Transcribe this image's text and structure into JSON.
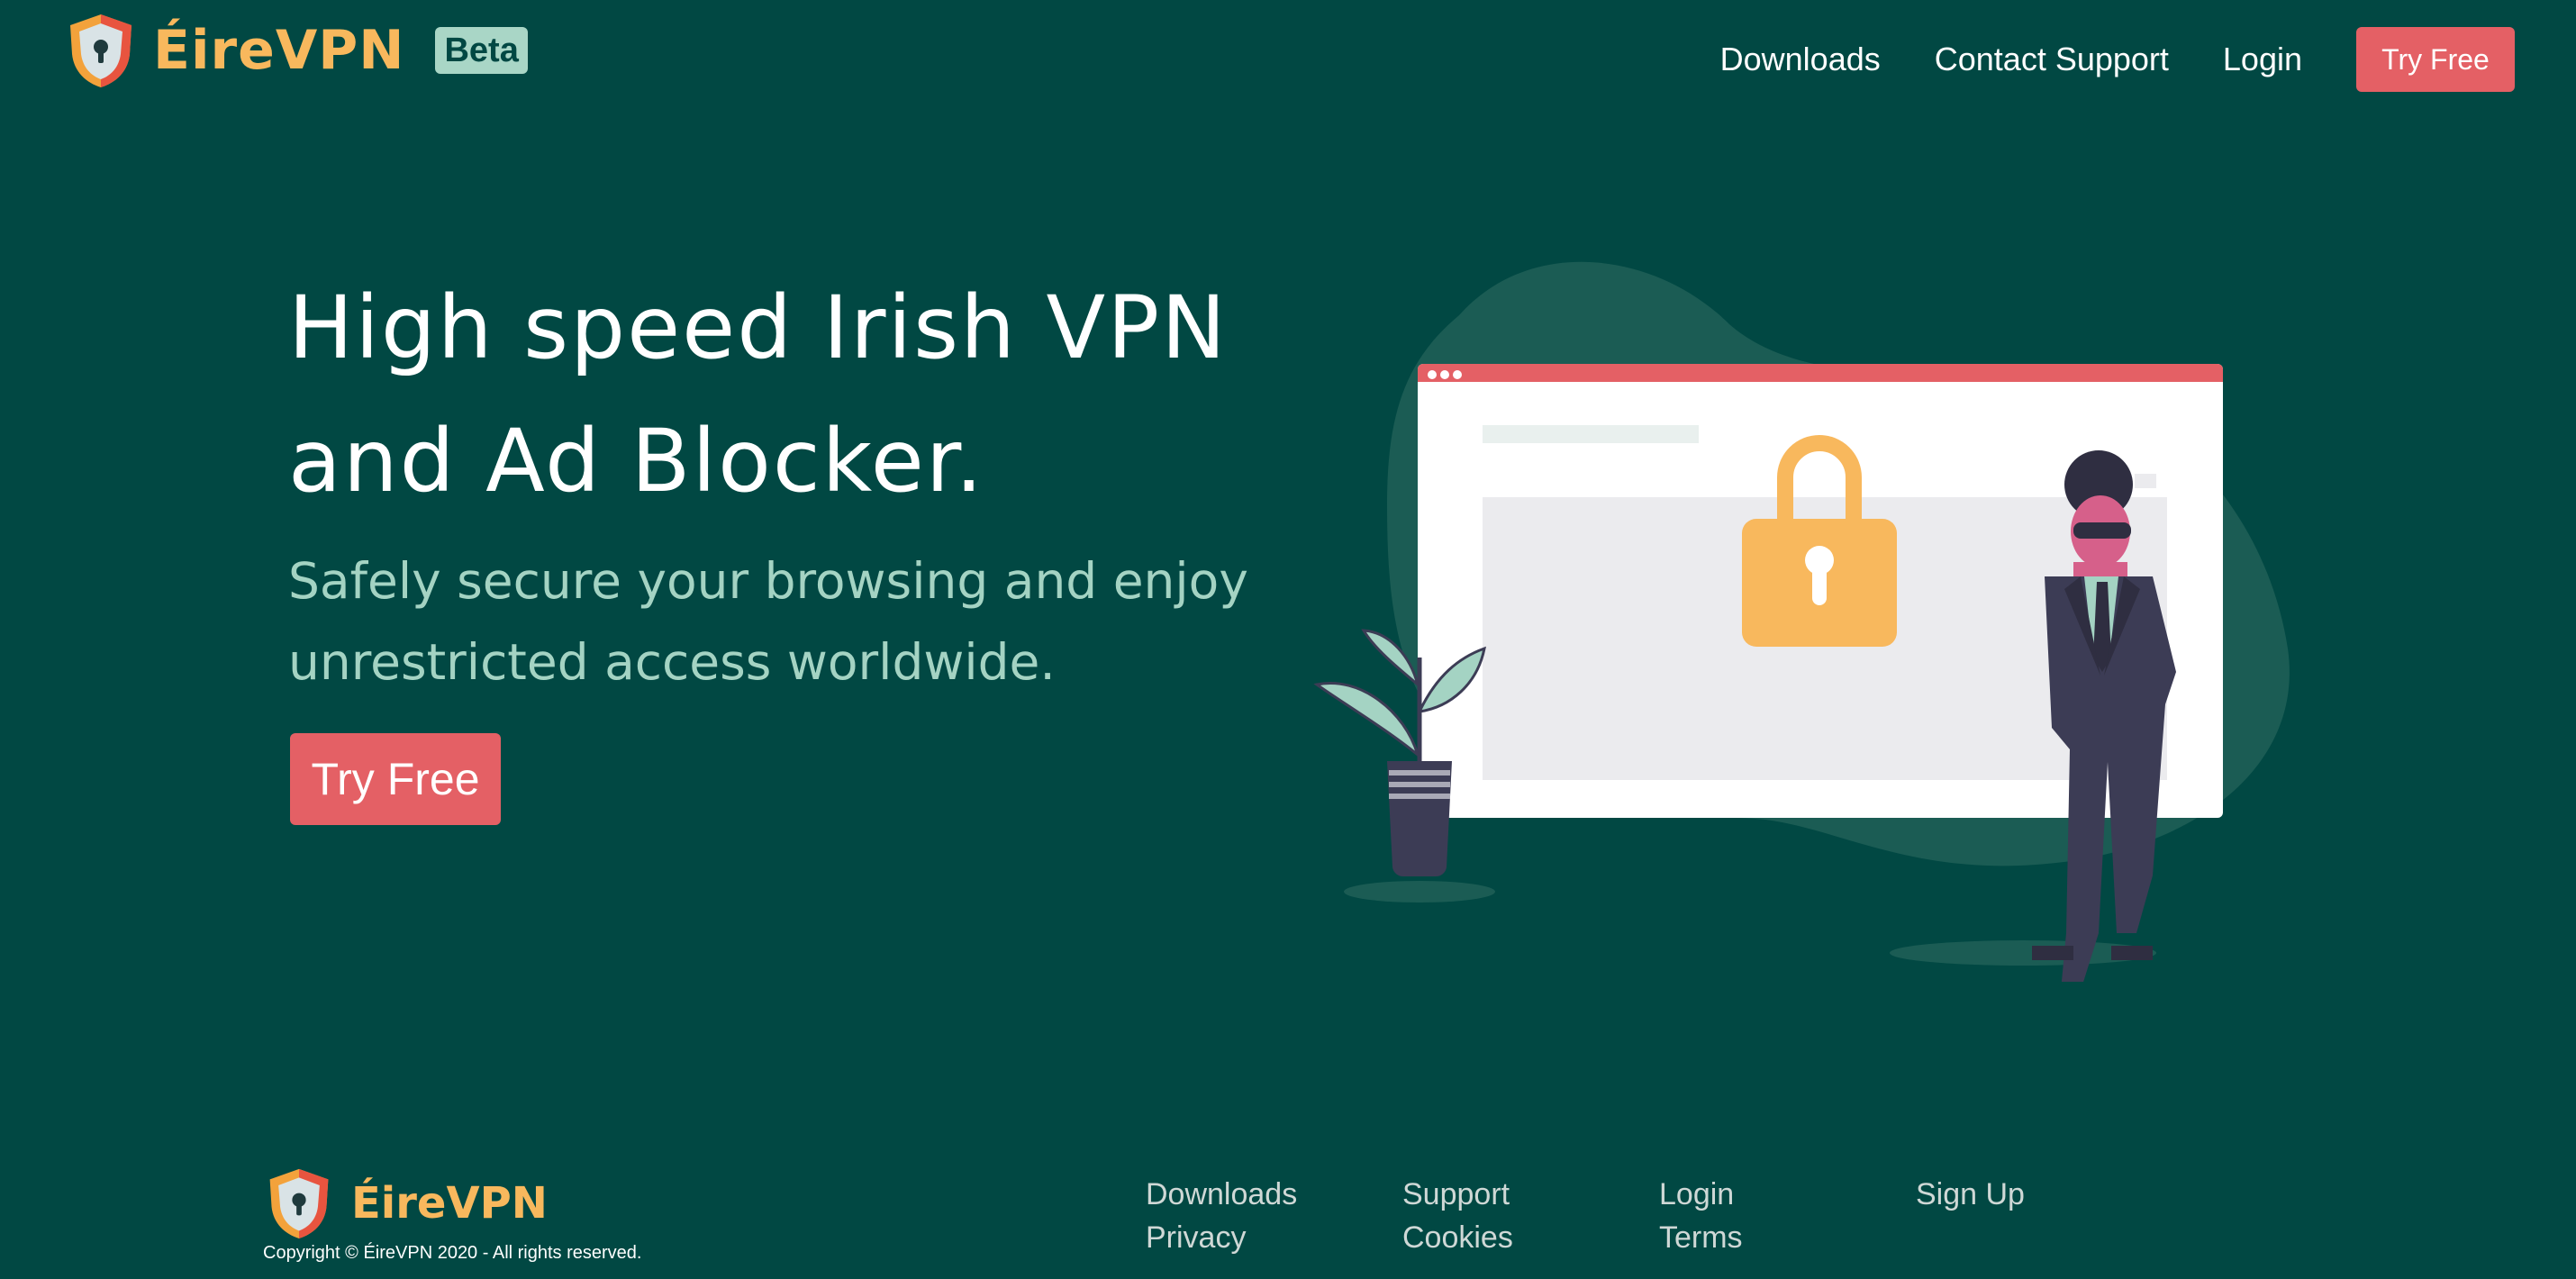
{
  "header": {
    "brand_name": "ÉireVPN",
    "beta_label": "Beta",
    "nav": {
      "downloads": "Downloads",
      "contact_support": "Contact Support",
      "login": "Login",
      "try_free": "Try Free"
    }
  },
  "hero": {
    "title_line1": "High speed Irish VPN",
    "title_line2": "and Ad Blocker.",
    "subtitle_line1": "Safely secure your browsing and enjoy",
    "subtitle_line2": "unrestricted access worldwide.",
    "cta_label": "Try Free",
    "illustration_icons": [
      "browser-window-icon",
      "padlock-icon",
      "plant-icon",
      "person-in-suit-icon"
    ]
  },
  "footer": {
    "brand_name": "ÉireVPN",
    "copyright": "Copyright © ÉireVPN 2020 - All rights reserved.",
    "columns": [
      [
        "Downloads",
        "Privacy"
      ],
      [
        "Support",
        "Cookies"
      ],
      [
        "Login",
        "Terms"
      ],
      [
        "Sign Up"
      ]
    ]
  },
  "colors": {
    "background": "#014843",
    "accent": "#e46065",
    "brand_orange": "#f8b85d",
    "beta_badge": "#a9d6c6",
    "subtitle": "#a4d3c3"
  },
  "icons": {
    "logo": "shield-keyhole-icon"
  }
}
